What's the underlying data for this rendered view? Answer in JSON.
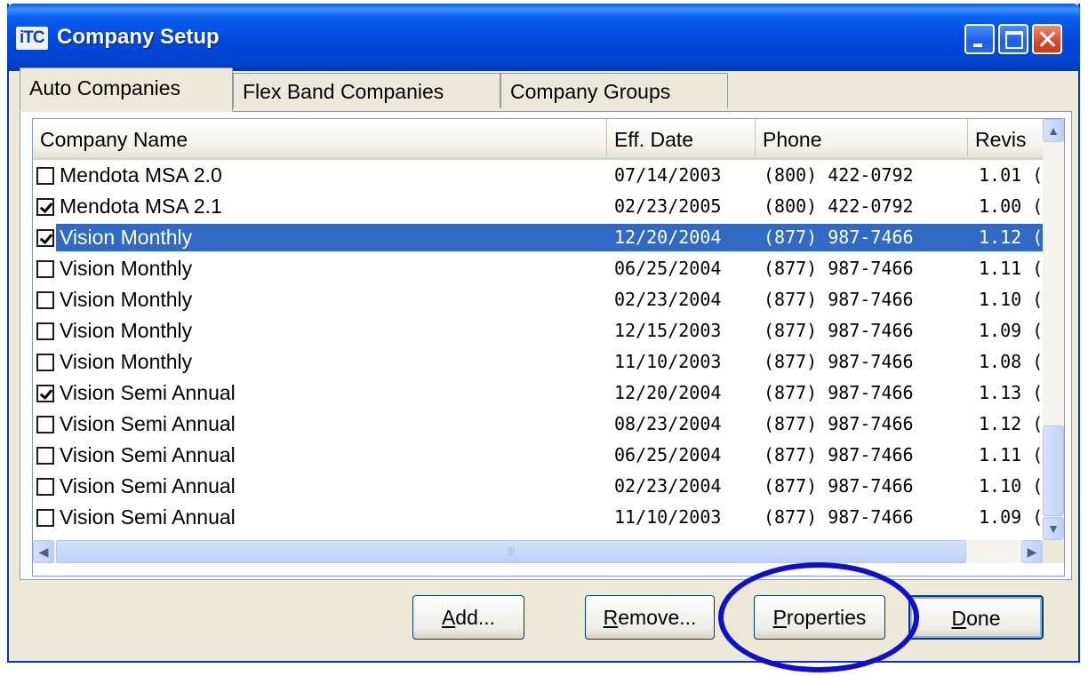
{
  "window": {
    "title": "Company Setup",
    "logo_text": "iTC"
  },
  "tabs": [
    {
      "label": "Auto Companies",
      "active": true
    },
    {
      "label": "Flex Band Companies",
      "active": false
    },
    {
      "label": "Company Groups",
      "active": false
    }
  ],
  "table": {
    "columns": [
      "Company Name",
      "Eff. Date",
      "Phone",
      "Revis"
    ],
    "rows": [
      {
        "checked": false,
        "name": "Mendota MSA 2.0",
        "date": "07/14/2003",
        "phone": "(800) 422-0792",
        "rev": "1.01 (·"
      },
      {
        "checked": true,
        "name": "Mendota MSA 2.1",
        "date": "02/23/2005",
        "phone": "(800) 422-0792",
        "rev": "1.00 (·"
      },
      {
        "checked": true,
        "name": "Vision Monthly",
        "date": "12/20/2004",
        "phone": "(877) 987-7466",
        "rev": "1.12 (",
        "selected": true
      },
      {
        "checked": false,
        "name": "Vision Monthly",
        "date": "06/25/2004",
        "phone": "(877) 987-7466",
        "rev": "1.11 (:"
      },
      {
        "checked": false,
        "name": "Vision Monthly",
        "date": "02/23/2004",
        "phone": "(877) 987-7466",
        "rev": "1.10 (:"
      },
      {
        "checked": false,
        "name": "Vision Monthly",
        "date": "12/15/2003",
        "phone": "(877) 987-7466",
        "rev": "1.09 (:"
      },
      {
        "checked": false,
        "name": "Vision Monthly",
        "date": "11/10/2003",
        "phone": "(877) 987-7466",
        "rev": "1.08 ("
      },
      {
        "checked": true,
        "name": "Vision Semi Annual",
        "date": "12/20/2004",
        "phone": "(877) 987-7466",
        "rev": "1.13 ("
      },
      {
        "checked": false,
        "name": "Vision Semi Annual",
        "date": "08/23/2004",
        "phone": "(877) 987-7466",
        "rev": "1.12 ("
      },
      {
        "checked": false,
        "name": "Vision Semi Annual",
        "date": "06/25/2004",
        "phone": "(877) 987-7466",
        "rev": "1.11 ("
      },
      {
        "checked": false,
        "name": "Vision Semi Annual",
        "date": "02/23/2004",
        "phone": "(877) 987-7466",
        "rev": "1.10 ("
      },
      {
        "checked": false,
        "name": "Vision Semi Annual",
        "date": "11/10/2003",
        "phone": "(877) 987-7466",
        "rev": "1.09 ("
      }
    ]
  },
  "buttons": {
    "add": {
      "mnemonic": "A",
      "rest": "dd..."
    },
    "remove": {
      "mnemonic": "R",
      "rest": "emove..."
    },
    "properties": {
      "mnemonic": "P",
      "rest": "roperties"
    },
    "done": {
      "mnemonic": "D",
      "rest": "one"
    }
  },
  "colors": {
    "selection": "#316ac5",
    "titlebar": "#0050e0",
    "highlight_ellipse": "#1010cc"
  }
}
